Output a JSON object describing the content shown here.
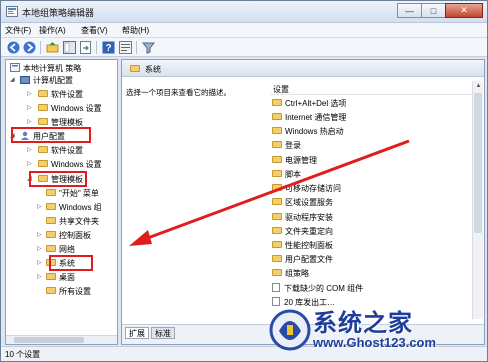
{
  "window": {
    "title": "本地组策略编辑器",
    "controls": {
      "minimize": "—",
      "maximize": "□",
      "close": "✕"
    }
  },
  "menubar": {
    "items": [
      "文件(F)",
      "操作(A)",
      "查看(V)",
      "帮助(H)"
    ]
  },
  "toolbar": {
    "icons": [
      "back-icon",
      "forward-icon",
      "up-folder-icon",
      "show-hide-tree-icon",
      "export-list-icon",
      "help-icon",
      "properties-icon",
      "filter-icon"
    ]
  },
  "tree": {
    "items": [
      {
        "label": "本地计算机 策略",
        "icon": "policy-icon"
      },
      {
        "label": "计算机配置",
        "icon": "computer-icon"
      },
      {
        "label": "软件设置",
        "icon": "folder-icon"
      },
      {
        "label": "Windows 设置",
        "icon": "folder-icon"
      },
      {
        "label": "管理模板",
        "icon": "folder-icon"
      },
      {
        "label": "用户配置",
        "icon": "user-icon"
      },
      {
        "label": "软件设置",
        "icon": "folder-icon"
      },
      {
        "label": "Windows 设置",
        "icon": "folder-icon"
      },
      {
        "label": "管理模板",
        "icon": "folder-icon"
      },
      {
        "label": "\"开始\" 菜单",
        "icon": "folder-icon"
      },
      {
        "label": "Windows 组",
        "icon": "folder-icon"
      },
      {
        "label": "共享文件夹",
        "icon": "folder-icon"
      },
      {
        "label": "控制面板",
        "icon": "folder-icon"
      },
      {
        "label": "网络",
        "icon": "folder-icon"
      },
      {
        "label": "系统",
        "icon": "folder-icon"
      },
      {
        "label": "桌面",
        "icon": "folder-icon"
      },
      {
        "label": "所有设置",
        "icon": "folder-icon"
      }
    ]
  },
  "right_pane": {
    "header": "系统",
    "description": "选择一个项目来查看它的描述。",
    "column": "设置",
    "items": [
      {
        "label": "Ctrl+Alt+Del 选项",
        "type": "folder"
      },
      {
        "label": "Internet 通信管理",
        "type": "folder"
      },
      {
        "label": "Windows 热启动",
        "type": "folder"
      },
      {
        "label": "登录",
        "type": "folder"
      },
      {
        "label": "电源管理",
        "type": "folder"
      },
      {
        "label": "脚本",
        "type": "folder"
      },
      {
        "label": "可移动存储访问",
        "type": "folder"
      },
      {
        "label": "区域设置服务",
        "type": "folder"
      },
      {
        "label": "驱动程序安装",
        "type": "folder"
      },
      {
        "label": "文件夹重定向",
        "type": "folder"
      },
      {
        "label": "性能控制面板",
        "type": "folder"
      },
      {
        "label": "用户配置文件",
        "type": "folder"
      },
      {
        "label": "组策略",
        "type": "folder"
      },
      {
        "label": "下载缺少的 COM 组件",
        "type": "setting"
      },
      {
        "label": "20 库发出工…",
        "type": "setting"
      }
    ],
    "tabs": [
      "扩展",
      "标准"
    ]
  },
  "statusbar": {
    "text": "10 个设置"
  },
  "watermark": {
    "brand": "系统之家",
    "url": "www.Ghost123.com"
  },
  "annotation_colors": {
    "highlight": "#e01d1d",
    "arrow": "#e01d1d"
  }
}
